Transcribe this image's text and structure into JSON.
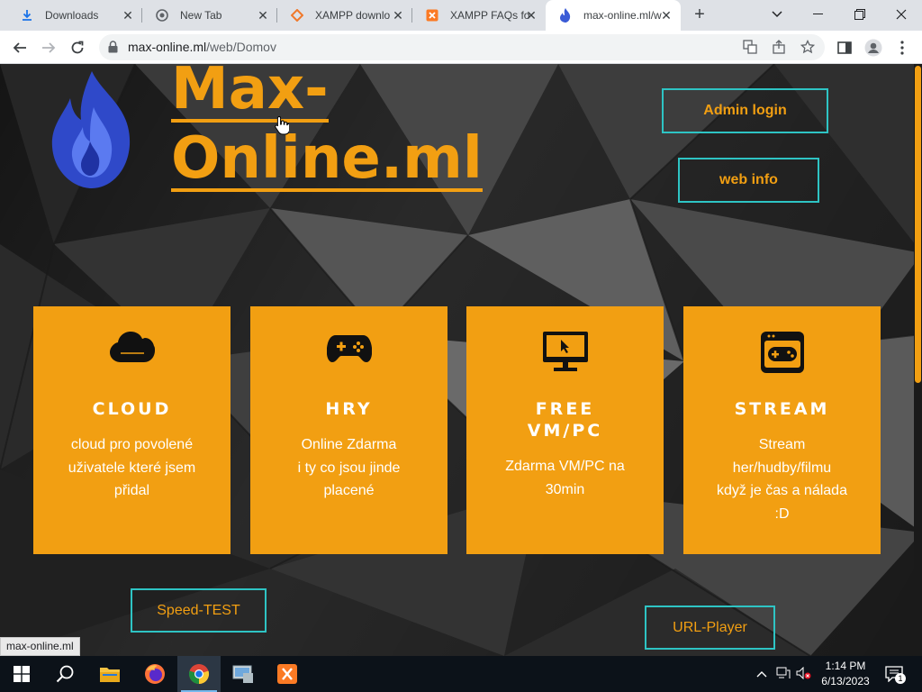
{
  "browser": {
    "tabs": [
      {
        "title": "Downloads",
        "icon": "download-icon",
        "active": false
      },
      {
        "title": "New Tab",
        "icon": "chrome-icon",
        "active": false
      },
      {
        "title": "XAMPP downlo",
        "icon": "xampp-diamond-icon",
        "active": false
      },
      {
        "title": "XAMPP FAQs fo",
        "icon": "xampp-icon",
        "active": false
      },
      {
        "title": "max-online.ml/w",
        "icon": "flame-favicon-icon",
        "active": true
      }
    ],
    "new_tab_symbol": "+",
    "address": {
      "host": "max-online.ml",
      "path": "/web/Domov"
    }
  },
  "site": {
    "brand_line1": "Max-",
    "brand_line2": "Online.ml",
    "admin_login": "Admin login",
    "web_info": "web info",
    "speed_test": "Speed-TEST",
    "url_player": "URL-Player",
    "cards": [
      {
        "icon": "cloud-icon",
        "title": "CLOUD",
        "text": "cloud pro povolené\nuživatele které jsem\npřidal"
      },
      {
        "icon": "gamepad-icon",
        "title": "HRY",
        "text": "Online Zdarma\ni ty co jsou jinde\nplacené"
      },
      {
        "icon": "monitor-pointer-icon",
        "title": "FREE\nVM/PC",
        "text": "Zdarma VM/PC na\n30min"
      },
      {
        "icon": "stream-console-icon",
        "title": "STREAM",
        "text": "Stream\nher/hudby/filmu\nkdyž je čas a nálada\n:D"
      }
    ],
    "accent_color": "#f29f12",
    "button_border_color": "#2ec4c4"
  },
  "status_bar": {
    "link_preview": "max-online.ml"
  },
  "taskbar": {
    "apps": [
      "start-icon",
      "search-icon",
      "file-explorer-icon",
      "firefox-icon",
      "chrome-icon",
      "control-panel-icon",
      "xampp-icon"
    ],
    "clock_time": "1:14 PM",
    "clock_date": "6/13/2023",
    "notification_count": "1"
  }
}
